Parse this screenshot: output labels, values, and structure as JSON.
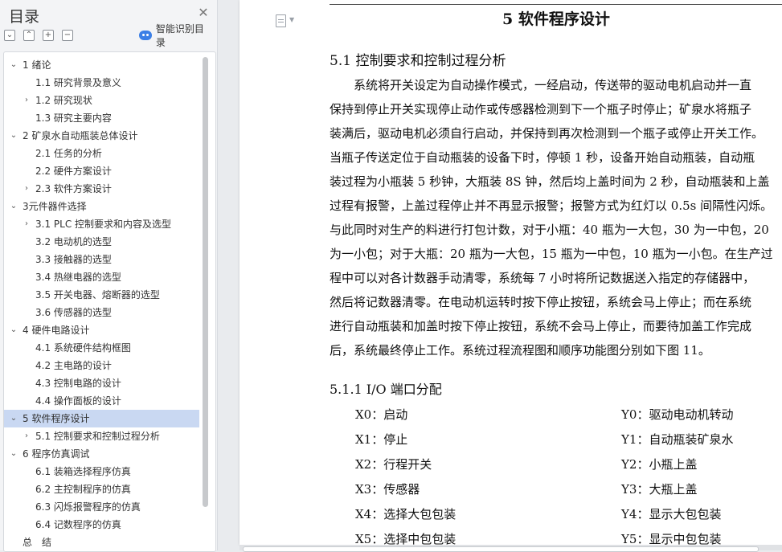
{
  "sidebar": {
    "title": "目录",
    "close_glyph": "✕",
    "tools": {
      "collapse": "⌄",
      "expand": "⌃",
      "add": "+",
      "remove": "−"
    },
    "smart_label": "智能识别目录",
    "toc": [
      {
        "label": "1  绪论",
        "level": 1,
        "arrow": "⌄"
      },
      {
        "label": "1.1 研究背景及意义",
        "level": 2,
        "arrow": ""
      },
      {
        "label": "1.2 研究现状",
        "level": 2,
        "arrow": "›"
      },
      {
        "label": "1.3 研究主要内容",
        "level": 2,
        "arrow": ""
      },
      {
        "label": "2  矿泉水自动瓶装总体设计",
        "level": 1,
        "arrow": "⌄"
      },
      {
        "label": "2.1 任务的分析",
        "level": 2,
        "arrow": ""
      },
      {
        "label": "2.2 硬件方案设计",
        "level": 2,
        "arrow": ""
      },
      {
        "label": "2.3 软件方案设计",
        "level": 2,
        "arrow": "›"
      },
      {
        "label": "3元件器件选择",
        "level": 1,
        "arrow": "⌄"
      },
      {
        "label": "3.1 PLC 控制要求和内容及选型",
        "level": 2,
        "arrow": "›"
      },
      {
        "label": "3.2 电动机的选型",
        "level": 2,
        "arrow": ""
      },
      {
        "label": "3.3 接触器的选型",
        "level": 2,
        "arrow": ""
      },
      {
        "label": "3.4 热继电器的选型",
        "level": 2,
        "arrow": ""
      },
      {
        "label": "3.5 开关电器、熔断器的选型",
        "level": 2,
        "arrow": ""
      },
      {
        "label": "3.6 传感器的选型",
        "level": 2,
        "arrow": ""
      },
      {
        "label": "4  硬件电路设计",
        "level": 1,
        "arrow": "⌄"
      },
      {
        "label": "4.1 系统硬件结构框图",
        "level": 2,
        "arrow": ""
      },
      {
        "label": "4.2 主电路的设计",
        "level": 2,
        "arrow": ""
      },
      {
        "label": "4.3 控制电路的设计",
        "level": 2,
        "arrow": ""
      },
      {
        "label": "4.4 操作面板的设计",
        "level": 2,
        "arrow": ""
      },
      {
        "label": "5  软件程序设计",
        "level": 1,
        "arrow": "⌄",
        "active": true
      },
      {
        "label": "5.1 控制要求和控制过程分析",
        "level": 2,
        "arrow": "›"
      },
      {
        "label": "6  程序仿真调试",
        "level": 1,
        "arrow": "⌄"
      },
      {
        "label": "6.1 装箱选择程序仿真",
        "level": 2,
        "arrow": ""
      },
      {
        "label": "6.2 主控制程序的仿真",
        "level": 2,
        "arrow": ""
      },
      {
        "label": "6.3 闪烁报警程序的仿真",
        "level": 2,
        "arrow": ""
      },
      {
        "label": "6.4 记数程序的仿真",
        "level": 2,
        "arrow": ""
      },
      {
        "label": "总　结",
        "level": 1,
        "arrow": ""
      }
    ]
  },
  "document": {
    "chapter_title": "5  软件程序设计",
    "section_title": "5.1 控制要求和控制过程分析",
    "paragraph_lines": [
      "　　系统将开关设定为自动操作模式，一经启动，传送带的驱动电机启动并一直",
      "保持到停止开关实现停止动作或传感器检测到下一个瓶子时停止；矿泉水将瓶子",
      "装满后，驱动电机必须自行启动，并保持到再次检测到一个瓶子或停止开关工作。",
      "当瓶子传送定位于自动瓶装的设备下时，停顿 1 秒，设备开始自动瓶装，自动瓶",
      "装过程为小瓶装 5 秒钟，大瓶装 8S 钟，然后均上盖时间为 2 秒，自动瓶装和上盖",
      "过程有报警，上盖过程停止并不再显示报警；报警方式为红灯以 0.5s 间隔性闪烁。",
      "与此同时对生产的料进行打包计数，对于小瓶：40 瓶为一大包，30 为一中包，20",
      "为一小包；对于大瓶：20 瓶为一大包，15 瓶为一中包，10 瓶为一小包。在生产过",
      "程中可以对各计数器手动清零，系统每 7 小时将所记数据送入指定的存储器中，",
      "然后将记数器清零。在电动机运转时按下停止按钮，系统会马上停止；而在系统",
      "进行自动瓶装和加盖时按下停止按钮，系统不会马上停止，而要待加盖工作完成",
      "后，系统最终停止工作。系统过程流程图和顺序功能图分别如下图 11。"
    ],
    "subsection_title": "5.1.1 I/O 端口分配",
    "io_inputs": [
      "X0：启动",
      "X1：停止",
      "X2：行程开关",
      "X3：传感器",
      "X4：选择大包包装",
      "X5：选择中包包装"
    ],
    "io_outputs": [
      "Y0：驱动电动机转动",
      "Y1：自动瓶装矿泉水",
      "Y2：小瓶上盖",
      "Y3：大瓶上盖",
      "Y4：显示大包包装",
      "Y5：显示中包包装"
    ]
  },
  "colors": {
    "accent": "#3b7fe6",
    "active_row": "#c9d8f2"
  }
}
